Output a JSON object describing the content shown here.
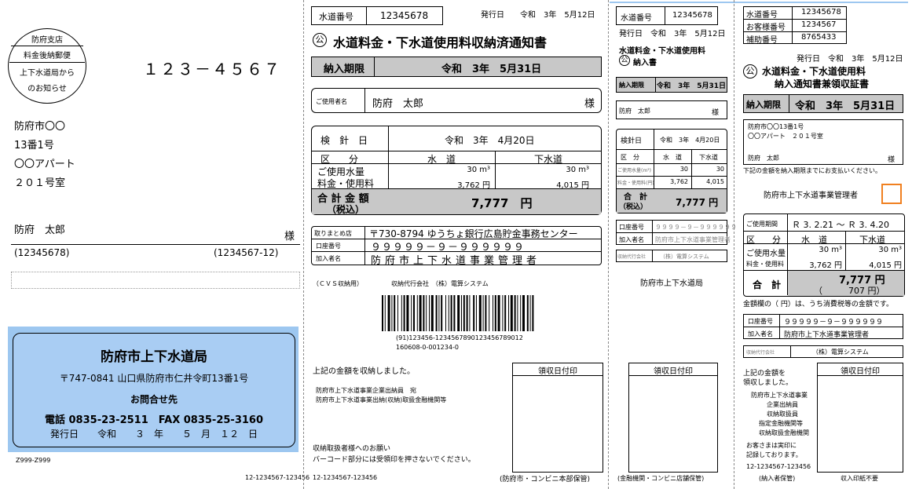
{
  "left": {
    "badge": {
      "line1": "防府支店",
      "line2": "料金後納郵便",
      "line3": "上下水道局から",
      "line4": "のお知らせ"
    },
    "postal": "１２３－４５６７",
    "addr1": "防府市〇〇",
    "addr2": "13番1号",
    "addr3": "〇〇アパート",
    "addr4": "２０１号室",
    "name": "防府　太郎",
    "sama": "様",
    "id1": "(12345678)",
    "id2": "(1234567-12)",
    "info": {
      "org": "防府市上下水道局",
      "addr": "〒747-0841 山口県防府市仁井令町13番1号",
      "contact": "お問合せ先",
      "tel": "電話 0835-23-2511　FAX 0835-25-3160",
      "issue": "発行日　　令和　　３　年　　５　月　１２　日"
    },
    "code_a": "Z999-Z999",
    "code_b": "12-1234567-123456"
  },
  "p2": {
    "water_no_label": "水道番号",
    "water_no": "12345678",
    "issue": "発行日　　令和　3年　5月12日",
    "title": "水道料金・下水道使用料収納済通知書",
    "ko": "公",
    "due_label": "納入期限",
    "due": "令和　3年　5月31日",
    "user_label": "ご使用者名",
    "user": "防府　太郎",
    "sama": "様",
    "read_label": "検　針　日",
    "read": "令和　3年　4月20日",
    "kubun": "区　　分",
    "water": "水　道",
    "sewer": "下水道",
    "usage_label": "ご使用水量",
    "usage_w": "30 m³",
    "usage_s": "30 m³",
    "fee_label": "料金・使用料",
    "fee_w": "3,762 円",
    "fee_s": "4,015 円",
    "total_label": "合 計 金 額",
    "tax": "（税込）",
    "total": "7,777　円",
    "bank_label": "取りまとめ店",
    "bank": "〒730-8794 ゆうちょ銀行広島貯金事務センター",
    "acct_label": "口座番号",
    "acct": "９９９９９－９－９９９９９９",
    "payee_label": "加入者名",
    "payee": "防府市上下水道事業管理者",
    "cvs": "（ＣＶＳ収納用）　　　　　収納代行会社　（株）電算システム",
    "bc1": "(91)123456-12345678901234567890​12",
    "bc2": "160608-0-001234-0",
    "received": "上記の金額を収納しました。",
    "notes1": "防府市上下水道事業企業出納員　宛",
    "notes2": "防府市上下水道事業出納(収納)取扱金融機関等",
    "stamp": "領収日付印",
    "req1": "収納取扱者様へのお願い",
    "req2": "バーコード部分には受領印を押さないでください。",
    "foot": "12-1234567-123456",
    "keep": "(防府市・コンビニ本部保管)"
  },
  "p3": {
    "water_no_label": "水道番号",
    "water_no": "12345678",
    "issue": "発行日　令和　3年　5月12日",
    "title1": "水道料金・下水道使用料",
    "title2": "納入書",
    "ko": "公",
    "due_label": "納入期限",
    "due": "令和　3年　5月31日",
    "user": "防府　太郎",
    "sama": "様",
    "read_label": "検針日",
    "read": "令和　3年　4月20日",
    "kubun": "区　分",
    "water": "水　道",
    "sewer": "下水道",
    "usage_label": "ご使用水量(m³)",
    "usage_w": "30",
    "usage_s": "30",
    "fee_label": "料金・使用料(円)",
    "fee_w": "3,762",
    "fee_s": "4,015",
    "total_label": "合　計",
    "tax": "（税込）",
    "total": "7,777 円",
    "acct_label": "口座番号",
    "acct": "９９９９－９－９９９９９９",
    "payee_label": "加入者名",
    "payee": "防府市上下水道事業管理者",
    "agent_label": "収納代行会社",
    "agent": "（株）電算システム",
    "org": "防府市上下水道局",
    "stamp": "領収日付印",
    "keep": "(金融機関・コンビニ店舗保管)"
  },
  "p4": {
    "water_no_label": "水道番号",
    "water_no": "12345678",
    "cust_label": "お客様番号",
    "cust_no": "1234567",
    "sub_label": "補助番号",
    "sub_no": "8765433",
    "issue": "発行日　令和　3年　5月12日",
    "title1": "水道料金・下水道使用料",
    "title2": "納入通知書兼領収証書",
    "ko": "公",
    "due_label": "納入期限",
    "due": "令和　3年　5月31日",
    "addr1": "防府市〇〇13番1号",
    "addr2": "〇〇アパート　２０１号室",
    "name": "防府　太郎",
    "sama": "様",
    "notice": "下記の金額を納入期限までにお支払いください。",
    "manager": "防府市上下水道事業管理者",
    "period_label": "ご使用期間",
    "period": "Ｒ 3. 2.21 ～ Ｒ 3. 4.20",
    "kubun": "区　　分",
    "water": "水　道",
    "sewer": "下水道",
    "usage_label": "ご使用水量",
    "usage_w": "30 m³",
    "usage_s": "30 m³",
    "fee_label": "料金・使用料",
    "fee_w": "3,762 円",
    "fee_s": "4,015 円",
    "total_label": "合　計",
    "total": "7,777 円",
    "tax": "（　　　707 円）",
    "tax_note": "金額欄の（ 円）は、うち消費税等の金額です。",
    "acct_label": "口座番号",
    "acct": "９９９９９－９－９９９９９９",
    "payee_label": "加入者名",
    "payee": "防府市上下水道事業管理者",
    "agent_label": "収納代行会社",
    "agent": "（株）電算システム",
    "recv1": "上記の金額を",
    "recv2": "領収しました。",
    "staff1": "防府市上下水道事業",
    "staff2": "企業出納員",
    "staff3": "収納取扱員",
    "staff4": "指定金融機関等",
    "staff5": "収納取扱金融機関",
    "note1": "お客さまは実印に",
    "note2": "記録しております。",
    "stamp": "領収日付印",
    "foot": "12-1234567-123456",
    "foot_l": "(納入者保管)",
    "foot_r": "収入印紙不要"
  }
}
